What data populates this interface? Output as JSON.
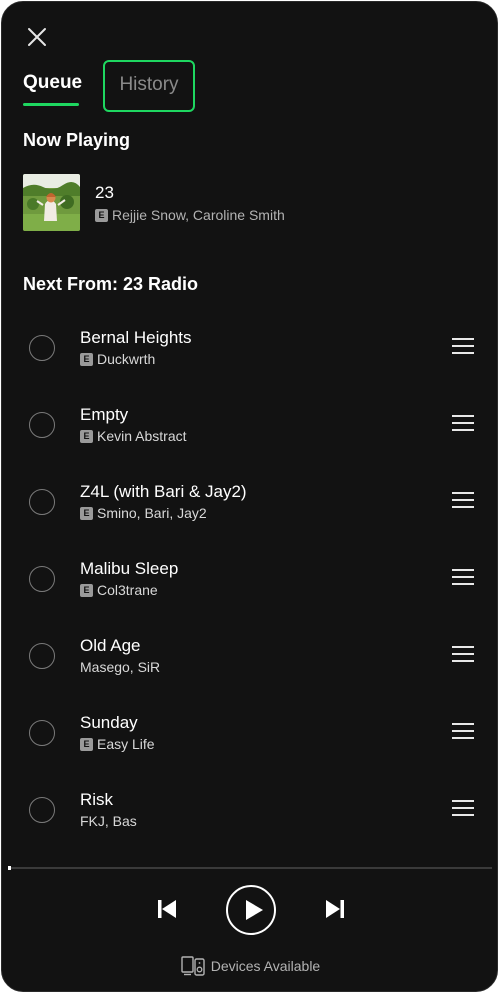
{
  "tabs": {
    "queue": "Queue",
    "history": "History"
  },
  "now_playing": {
    "heading": "Now Playing",
    "title": "23",
    "artists": "Rejjie Snow, Caroline Smith",
    "explicit": true,
    "explicit_badge": "E"
  },
  "next_from": {
    "heading": "Next From: 23 Radio",
    "tracks": [
      {
        "title": "Bernal Heights",
        "artists": "Duckwrth",
        "explicit": true,
        "badge": "E"
      },
      {
        "title": "Empty",
        "artists": "Kevin Abstract",
        "explicit": true,
        "badge": "E"
      },
      {
        "title": "Z4L (with Bari & Jay2)",
        "artists": "Smino, Bari, Jay2",
        "explicit": true,
        "badge": "E"
      },
      {
        "title": "Malibu Sleep",
        "artists": "Col3trane",
        "explicit": true,
        "badge": "E"
      },
      {
        "title": "Old Age",
        "artists": "Masego, SiR",
        "explicit": false,
        "badge": ""
      },
      {
        "title": "Sunday",
        "artists": "Easy Life",
        "explicit": true,
        "badge": "E"
      },
      {
        "title": "Risk",
        "artists": "FKJ, Bas",
        "explicit": false,
        "badge": ""
      }
    ]
  },
  "footer": {
    "devices_label": "Devices Available"
  },
  "icons": {
    "close": "close-icon",
    "prev": "skip-previous-icon",
    "play": "play-icon",
    "next": "skip-next-icon",
    "devices": "devices-icon",
    "drag": "drag-handle-icon"
  },
  "colors": {
    "background": "#121212",
    "accent": "#1ed760",
    "text_primary": "#ffffff",
    "text_secondary": "#b3b3b3",
    "muted_tab": "#8a8a8a"
  }
}
